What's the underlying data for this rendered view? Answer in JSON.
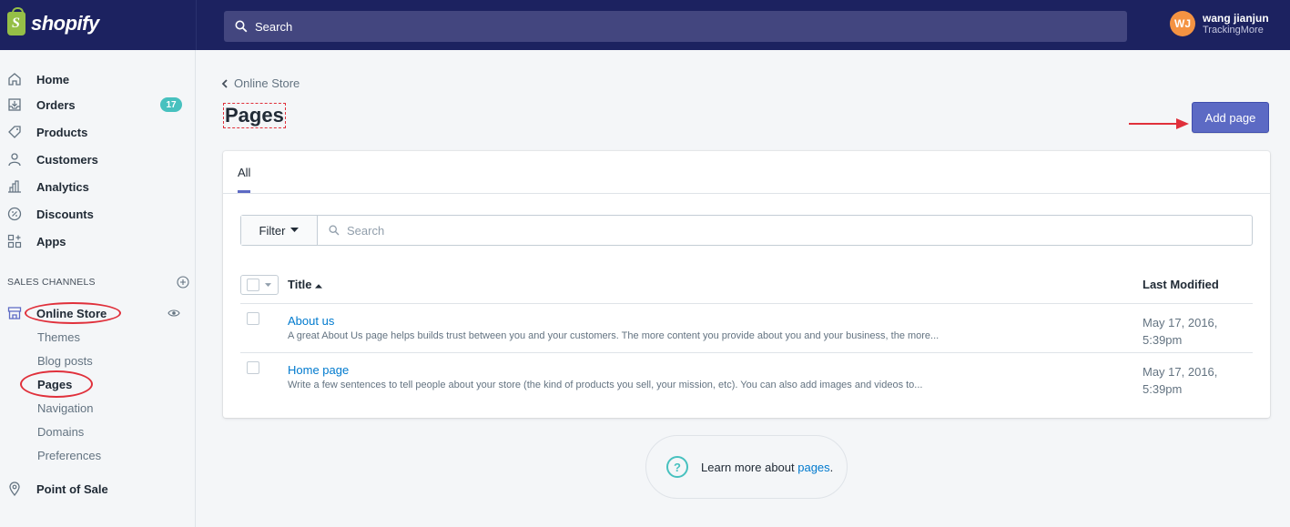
{
  "topbar": {
    "logo_text": "shopify",
    "logo_bag_letter": "S",
    "search_placeholder": "Search",
    "user_initials": "WJ",
    "user_name": "wang jianjun",
    "store_name": "TrackingMore"
  },
  "sidebar": {
    "items": [
      {
        "label": "Home",
        "icon": "home-icon"
      },
      {
        "label": "Orders",
        "icon": "orders-icon",
        "badge": "17"
      },
      {
        "label": "Products",
        "icon": "tag-icon"
      },
      {
        "label": "Customers",
        "icon": "person-icon"
      },
      {
        "label": "Analytics",
        "icon": "bar-chart-icon"
      },
      {
        "label": "Discounts",
        "icon": "discount-icon"
      },
      {
        "label": "Apps",
        "icon": "apps-icon"
      }
    ],
    "sales_channels_label": "SALES CHANNELS",
    "online_store_label": "Online Store",
    "sub_items": [
      "Themes",
      "Blog posts",
      "Pages",
      "Navigation",
      "Domains",
      "Preferences"
    ],
    "active_sub_item": "Pages",
    "point_of_sale_label": "Point of Sale"
  },
  "main": {
    "breadcrumb": "Online Store",
    "title": "Pages",
    "add_button": "Add page",
    "tab_all": "All",
    "filter_label": "Filter",
    "search_placeholder": "Search",
    "columns": {
      "title": "Title",
      "last_modified": "Last Modified"
    },
    "rows": [
      {
        "title": "About us",
        "description": "A great About Us page helps builds trust between you and your customers. The more content you provide about you and your business, the more...",
        "date_line1": "May 17, 2016,",
        "date_line2": "5:39pm"
      },
      {
        "title": "Home page",
        "description": "Write a few sentences to tell people about your store (the kind of products you sell, your mission, etc). You can also add images and videos to...",
        "date_line1": "May 17, 2016,",
        "date_line2": "5:39pm"
      }
    ],
    "help_prefix": "Learn more about ",
    "help_link": "pages",
    "help_suffix": "."
  },
  "colors": {
    "topbar": "#1c2260",
    "primary_button": "#5c6ac4",
    "link": "#007ace",
    "badge": "#47c1bf",
    "annotation": "#e0303b"
  }
}
